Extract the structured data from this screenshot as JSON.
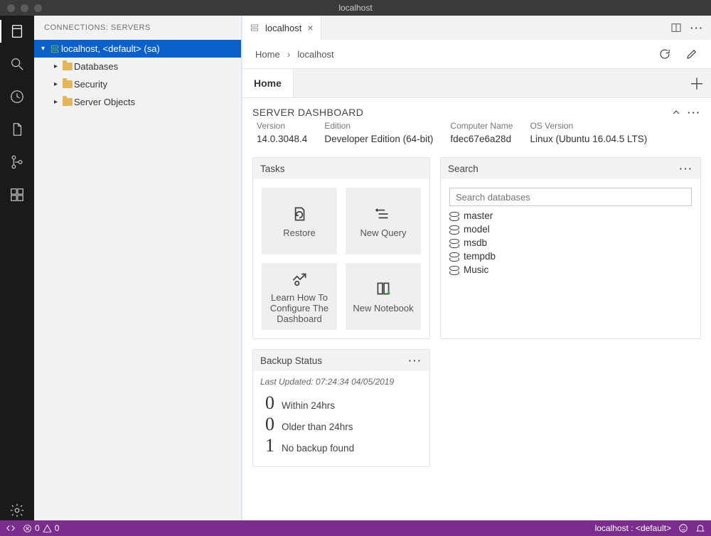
{
  "window": {
    "title": "localhost"
  },
  "sidebar": {
    "header": "CONNECTIONS: SERVERS",
    "server": {
      "label": "localhost, <default> (sa)"
    },
    "nodes": [
      {
        "label": "Databases"
      },
      {
        "label": "Security"
      },
      {
        "label": "Server Objects"
      }
    ]
  },
  "tab": {
    "label": "localhost"
  },
  "breadcrumb": {
    "root": "Home",
    "current": "localhost"
  },
  "home": {
    "tab_label": "Home"
  },
  "dashboard": {
    "title": "SERVER DASHBOARD",
    "props": [
      {
        "k": "Version",
        "v": "14.0.3048.4"
      },
      {
        "k": "Edition",
        "v": "Developer Edition (64-bit)"
      },
      {
        "k": "Computer Name",
        "v": "fdec67e6a28d"
      },
      {
        "k": "OS Version",
        "v": "Linux (Ubuntu 16.04.5 LTS)"
      }
    ]
  },
  "tasks": {
    "title": "Tasks",
    "items": [
      {
        "label": "Restore"
      },
      {
        "label": "New Query"
      },
      {
        "label": "Learn How To Configure The Dashboard"
      },
      {
        "label": "New Notebook"
      }
    ]
  },
  "search": {
    "title": "Search",
    "placeholder": "Search databases",
    "databases": [
      {
        "name": "master"
      },
      {
        "name": "model"
      },
      {
        "name": "msdb"
      },
      {
        "name": "tempdb"
      },
      {
        "name": "Music"
      }
    ]
  },
  "backup": {
    "title": "Backup Status",
    "last_updated": "Last Updated: 07:24:34 04/05/2019",
    "stats": [
      {
        "n": "0",
        "label": "Within 24hrs"
      },
      {
        "n": "0",
        "label": "Older than 24hrs"
      },
      {
        "n": "1",
        "label": "No backup found"
      }
    ]
  },
  "status": {
    "errors": "0",
    "warnings": "0",
    "connection": "localhost : <default>"
  }
}
